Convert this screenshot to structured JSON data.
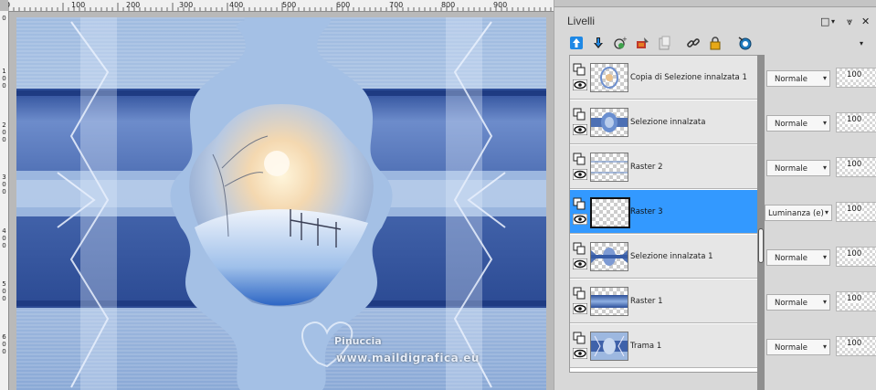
{
  "ruler": {
    "top_labels": [
      "0",
      "100",
      "200",
      "300",
      "400",
      "500",
      "600",
      "700",
      "800",
      "900"
    ],
    "left_labels": [
      "0",
      "1\n0\n0",
      "2\n0\n0",
      "3\n0\n0",
      "4\n0\n0",
      "5\n0\n0",
      "6\n0\n0"
    ]
  },
  "watermark": {
    "name": "Pinuccia",
    "url": "www.maildigrafica.eu"
  },
  "panel": {
    "title": "Livelli",
    "toolbar_icons": [
      "move-layer-up-icon",
      "move-layer-down-icon",
      "new-layer-icon",
      "paint-layer-icon",
      "duplicate-layer-icon",
      "link-layer-icon",
      "lock-layer-icon",
      "mask-icon"
    ]
  },
  "layers": [
    {
      "name": "Copia di Selezione innalzata 1",
      "blend": "Normale",
      "opacity": "100",
      "active": false,
      "thumb": "copy-selection-thumb"
    },
    {
      "name": "Selezione innalzata",
      "blend": "Normale",
      "opacity": "100",
      "active": false,
      "thumb": "selection-thumb"
    },
    {
      "name": "Raster 2",
      "blend": "Normale",
      "opacity": "100",
      "active": false,
      "thumb": "raster2-thumb"
    },
    {
      "name": "Raster 3",
      "blend": "Luminanza (e)",
      "opacity": "100",
      "active": true,
      "thumb": "raster3-thumb"
    },
    {
      "name": "Selezione innalzata 1",
      "blend": "Normale",
      "opacity": "100",
      "active": false,
      "thumb": "selection1-thumb"
    },
    {
      "name": "Raster 1",
      "blend": "Normale",
      "opacity": "100",
      "active": false,
      "thumb": "raster1-thumb"
    },
    {
      "name": "Trama 1",
      "blend": "Normale",
      "opacity": "100",
      "active": false,
      "thumb": "trama-thumb"
    }
  ],
  "colors": {
    "selected_row": "#3399ff",
    "canvas_blue": "#4c6fae",
    "pale_blue": "#a9c3e4"
  }
}
